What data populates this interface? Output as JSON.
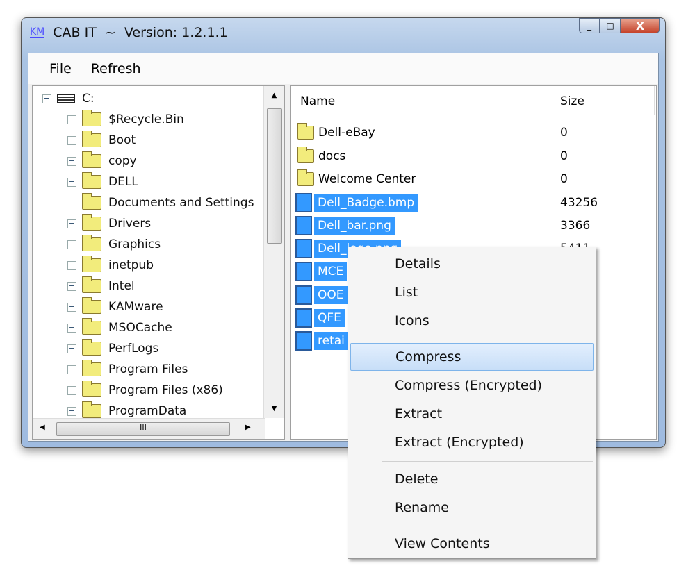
{
  "window": {
    "title": "CAB IT  ~  Version: 1.2.1.1",
    "logo": "KM",
    "minimize": "_",
    "maximize": "□",
    "close": "X"
  },
  "menubar": [
    "File",
    "Refresh"
  ],
  "tree": {
    "root": "C:",
    "items": [
      {
        "label": "$Recycle.Bin",
        "expandable": true
      },
      {
        "label": "Boot",
        "expandable": true
      },
      {
        "label": "copy",
        "expandable": true
      },
      {
        "label": "DELL",
        "expandable": true
      },
      {
        "label": "Documents and Settings",
        "expandable": false
      },
      {
        "label": "Drivers",
        "expandable": true
      },
      {
        "label": "Graphics",
        "expandable": true
      },
      {
        "label": "inetpub",
        "expandable": true
      },
      {
        "label": "Intel",
        "expandable": true
      },
      {
        "label": "KAMware",
        "expandable": true
      },
      {
        "label": "MSOCache",
        "expandable": true
      },
      {
        "label": "PerfLogs",
        "expandable": true
      },
      {
        "label": "Program Files",
        "expandable": true
      },
      {
        "label": "Program Files (x86)",
        "expandable": true
      },
      {
        "label": "ProgramData",
        "expandable": true
      }
    ],
    "hscroll_grip": "III"
  },
  "list": {
    "columns": [
      "Name",
      "Size"
    ],
    "rows": [
      {
        "name": "Dell-eBay",
        "size": "0",
        "type": "folder",
        "selected": false
      },
      {
        "name": "docs",
        "size": "0",
        "type": "folder",
        "selected": false
      },
      {
        "name": "Welcome Center",
        "size": "0",
        "type": "folder",
        "selected": false
      },
      {
        "name": "Dell_Badge.bmp",
        "size": "43256",
        "type": "file",
        "selected": true
      },
      {
        "name": "Dell_bar.png",
        "size": "3366",
        "type": "file",
        "selected": true
      },
      {
        "name": "Dell_logo.png",
        "size": "5411",
        "type": "file",
        "selected": true
      },
      {
        "name": "MCE",
        "size": "",
        "type": "file",
        "selected": true
      },
      {
        "name": "OOE",
        "size": "",
        "type": "file",
        "selected": true
      },
      {
        "name": "QFE",
        "size": "",
        "type": "file",
        "selected": true
      },
      {
        "name": "retai",
        "size": "",
        "type": "file",
        "selected": true
      }
    ]
  },
  "context_menu": {
    "items": [
      "Details",
      "List",
      "Icons",
      "Compress",
      "Compress (Encrypted)",
      "Extract",
      "Extract (Encrypted)",
      "Delete",
      "Rename",
      "View Contents"
    ],
    "highlighted": "Compress"
  },
  "colors": {
    "selection": "#3399ff",
    "folder": "#f2ec7c"
  }
}
